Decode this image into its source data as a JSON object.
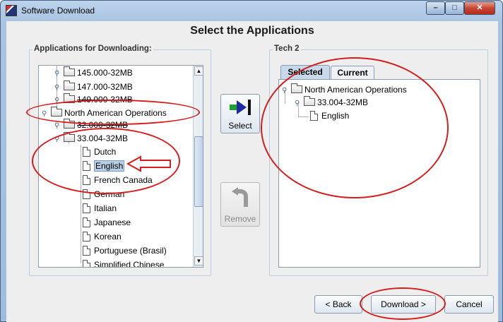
{
  "window": {
    "title": "Software Download",
    "minimize_glyph": "–",
    "maximize_glyph": "□",
    "close_glyph": "✕",
    "icon": "java-app-icon"
  },
  "heading": "Select the Applications",
  "left_panel": {
    "label": "Applications for Downloading:",
    "tree": [
      {
        "label": "145.000-32MB",
        "type": "folder"
      },
      {
        "label": "147.000-32MB",
        "type": "folder"
      },
      {
        "label": "149.000-32MB",
        "type": "folder"
      },
      {
        "label": "North American Operations",
        "type": "folder"
      },
      {
        "label": "32.000-32MB",
        "type": "folder"
      },
      {
        "label": "33.004-32MB",
        "type": "folder"
      },
      {
        "label": "Dutch",
        "type": "file"
      },
      {
        "label": "English",
        "type": "file",
        "selected": true
      },
      {
        "label": "French Canada",
        "type": "file"
      },
      {
        "label": "German",
        "type": "file"
      },
      {
        "label": "Italian",
        "type": "file"
      },
      {
        "label": "Japanese",
        "type": "file"
      },
      {
        "label": "Korean",
        "type": "file"
      },
      {
        "label": "Portuguese (Brasil)",
        "type": "file"
      },
      {
        "label": "Simplified Chinese",
        "type": "file"
      }
    ]
  },
  "select_button": {
    "label": "Select",
    "icon": "arrow-right-to-bar-icon"
  },
  "remove_button": {
    "label": "Remove",
    "icon": "curved-arrow-back-icon"
  },
  "right_panel": {
    "label": "Tech 2",
    "tabs": [
      {
        "label": "Selected",
        "active": true
      },
      {
        "label": "Current",
        "active": false
      }
    ],
    "tree": [
      {
        "label": "North American Operations",
        "type": "folder"
      },
      {
        "label": "33.004-32MB",
        "type": "folder"
      },
      {
        "label": "English",
        "type": "file"
      }
    ]
  },
  "footer": {
    "back_label": "< Back",
    "download_label": "Download >",
    "cancel_label": "Cancel"
  },
  "colors": {
    "annotation_red": "#d21e1e",
    "selection_blue": "#b8cfe5",
    "window_frame": "#a9c4e2"
  }
}
